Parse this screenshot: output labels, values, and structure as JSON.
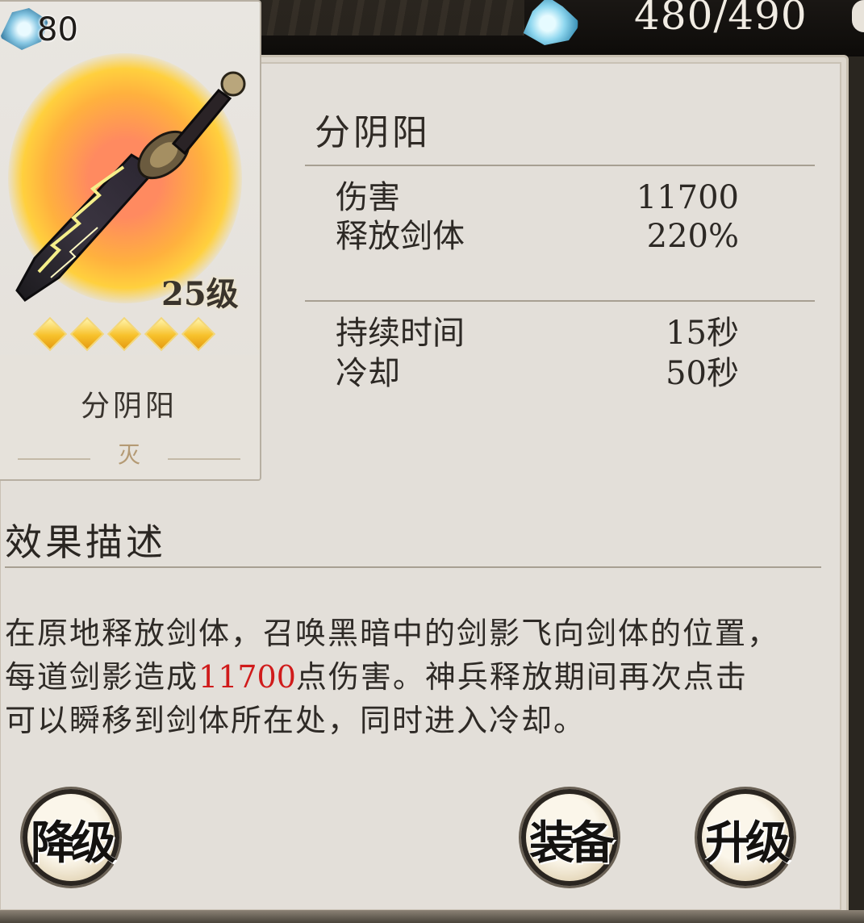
{
  "topbar": {
    "energy": "480/490",
    "stack_count": "80"
  },
  "card": {
    "level": "25级",
    "stars": 5,
    "name": "分阴阳",
    "rank": "灭"
  },
  "info": {
    "title": "分阴阳",
    "stats_group1": [
      {
        "label": "伤害",
        "value": "11700"
      },
      {
        "label": "释放剑体",
        "value": "220%"
      }
    ],
    "stats_group2": [
      {
        "label": "持续时间",
        "value": "15秒"
      },
      {
        "label": "冷却",
        "value": "50秒"
      }
    ]
  },
  "effect": {
    "title": "效果描述",
    "desc_part1": "在原地释放剑体，召唤黑暗中的剑影飞向剑体的位置，每道剑影造成",
    "desc_highlight": "11700",
    "desc_part2": "点伤害。神兵释放期间再次点击可以瞬移到剑体所在处，同时进入冷却。"
  },
  "buttons": {
    "downgrade": "降级",
    "equip": "装备",
    "upgrade": "升级"
  },
  "colors": {
    "highlight": "#d01b1b",
    "panel_bg": "#e3dfd9"
  }
}
